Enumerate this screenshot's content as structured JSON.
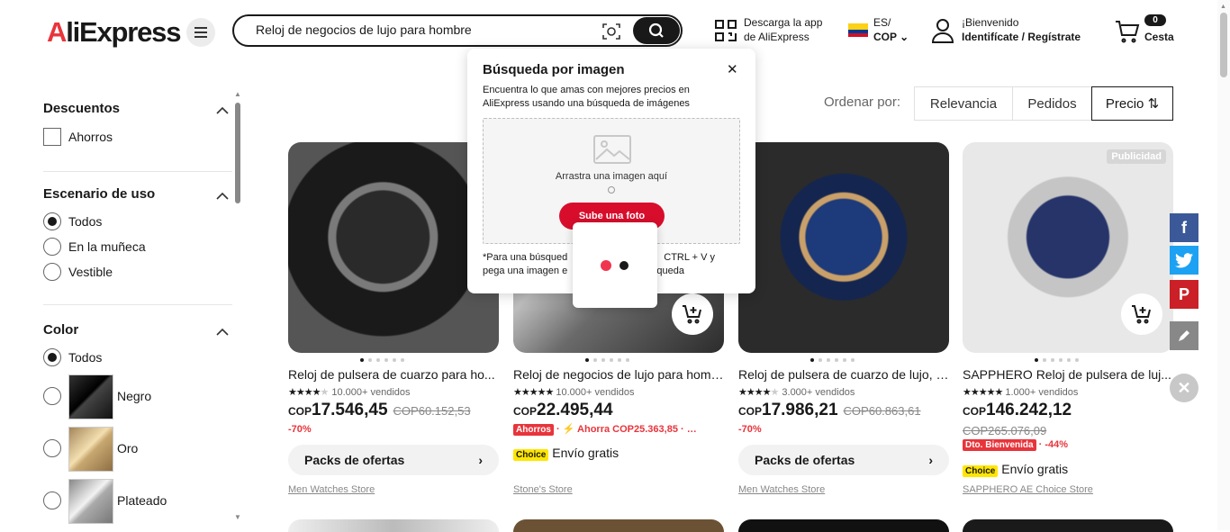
{
  "header": {
    "logo_prefix": "A",
    "logo_rest": "liExpress",
    "search_value": "Reloj de negocios de lujo para hombre",
    "app_line1": "Descarga la app",
    "app_line2": "de AliExpress",
    "lang": "ES/",
    "currency": "COP",
    "welcome": "¡Bienvenido",
    "signin": "Identifícate / Regístrate",
    "cart_count": "0",
    "cart_label": "Cesta"
  },
  "popup": {
    "title": "Búsqueda por imagen",
    "desc": "Encuentra lo que amas con mejores precios en AliExpress usando una búsqueda de imágenes",
    "drop_text": "Arrastra una imagen aquí",
    "upload_label": "Sube una foto",
    "note_left1": "*Para una búsqued",
    "note_right1": "CTRL + V y",
    "note_left2": "pega una imagen e",
    "note_right2": "queda"
  },
  "sidebar": {
    "discounts_title": "Descuentos",
    "discounts_opt": "Ahorros",
    "usage_title": "Escenario de uso",
    "usage_opts": [
      "Todos",
      "En la muñeca",
      "Vestible"
    ],
    "color_title": "Color",
    "color_all": "Todos",
    "colors": [
      "Negro",
      "Oro",
      "Plateado"
    ]
  },
  "sort": {
    "label": "Ordenar por:",
    "relevance": "Relevancia",
    "orders": "Pedidos",
    "price": "Precio"
  },
  "products": [
    {
      "title": "Reloj de pulsera de cuarzo para ho...",
      "sold": "10.000+ vendidos",
      "cur": "COP",
      "price": "17.546,45",
      "old": "COP60.152,53",
      "disc": "-70%",
      "pack": "Packs de ofertas",
      "store": "Men Watches Store"
    },
    {
      "title": "Reloj de negocios de lujo para homb...",
      "sold": "10.000+ vendidos",
      "cur": "COP",
      "price": "22.495,44",
      "tag": "Ahorros",
      "savings": "Ahorra COP25.363,85",
      "choice": "Choice",
      "shipping": "Envío gratis",
      "store": "Stone's Store"
    },
    {
      "title": "Reloj de pulsera de cuarzo de lujo, r...",
      "sold": "3.000+ vendidos",
      "cur": "COP",
      "price": "17.986,21",
      "old": "COP60.863,61",
      "disc": "-70%",
      "pack": "Packs de ofertas",
      "store": "Men Watches Store"
    },
    {
      "title": "SAPPHERO Reloj de pulsera de luj...",
      "sold": "1.000+ vendidos",
      "cur": "COP",
      "price": "146.242,12",
      "old": "COP265.076,09",
      "tag": "Dto. Bienvenida",
      "disc": "-44%",
      "choice": "Choice",
      "shipping": "Envío gratis",
      "store": "SAPPHERO AE Choice Store",
      "ad": "Publicidad"
    }
  ]
}
